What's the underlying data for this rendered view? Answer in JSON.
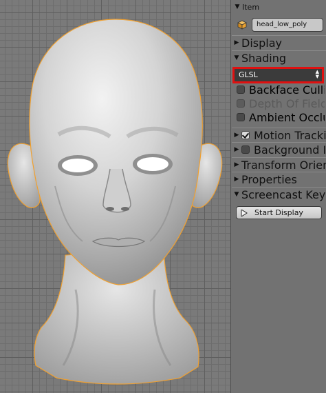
{
  "viewport": {
    "object_name": "head_low_poly",
    "selection_color": "#f0a030"
  },
  "panel": {
    "sections": {
      "item": {
        "label": "Item",
        "expanded": true
      },
      "display": {
        "label": "Display",
        "expanded": false
      },
      "shading": {
        "label": "Shading",
        "expanded": true
      },
      "motion_tracking": {
        "label": "Motion Tracking",
        "expanded": false,
        "checked": true
      },
      "background_images": {
        "label": "Background Images",
        "expanded": false,
        "checked": false
      },
      "transform_orientations": {
        "label": "Transform Orientations",
        "expanded": false
      },
      "properties": {
        "label": "Properties",
        "expanded": false
      },
      "screencast_keys": {
        "label": "Screencast Keys",
        "expanded": true
      }
    },
    "item_name": "head_low_poly",
    "shading_mode": "GLSL",
    "shading_options": {
      "backface_culling": {
        "label": "Backface Culling",
        "checked": false
      },
      "depth_of_field": {
        "label": "Depth Of Field",
        "checked": false,
        "enabled": false
      },
      "ambient_occlusion": {
        "label": "Ambient Occlusion",
        "checked": false
      }
    },
    "start_display_label": "Start Display",
    "highlight_color": "#e01010"
  }
}
